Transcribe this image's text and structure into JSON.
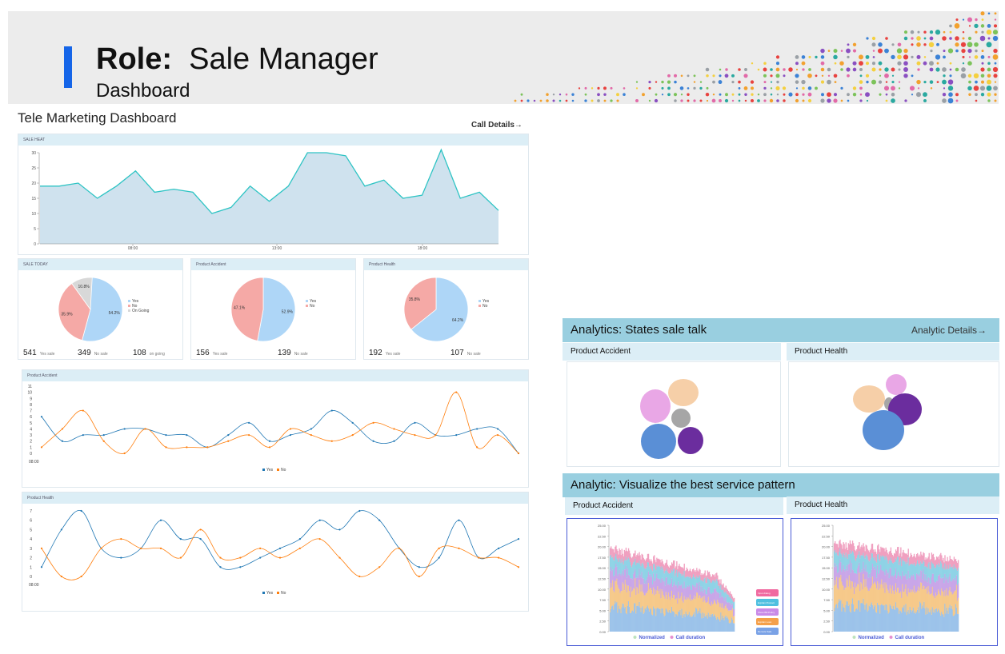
{
  "header": {
    "role_label": "Role:",
    "role_value": "Sale Manager",
    "subtitle": "Dashboard"
  },
  "tele": {
    "title": "Tele Marketing Dashboard",
    "call_details": "Call Details→",
    "sale_heat": {
      "label": "SALE HEAT",
      "yticks": [
        "30",
        "25",
        "20",
        "15",
        "10",
        "5",
        "0"
      ],
      "xticks": [
        "08:00",
        "13:00",
        "18:00"
      ],
      "values": [
        19,
        19,
        20,
        15,
        19,
        24,
        17,
        18,
        17,
        10,
        12,
        19,
        14,
        19,
        30,
        30,
        29,
        19,
        21,
        15,
        16,
        31,
        15,
        17,
        11
      ],
      "colors": {
        "line": "#2ec4c4",
        "fill": "#cfe2ee"
      }
    },
    "sale_today": {
      "label": "SALE TODAY",
      "pct": [
        "54.2%",
        "35.9%",
        "10.8%"
      ],
      "legend": [
        "Yes",
        "No",
        "On Going"
      ],
      "stats": [
        {
          "n": "541",
          "t": "Yes sale"
        },
        {
          "n": "349",
          "t": "No sale"
        },
        {
          "n": "108",
          "t": "on going"
        }
      ]
    },
    "pie_accident": {
      "label": "Product Accident",
      "pct": [
        "52.9%",
        "47.1%"
      ],
      "legend": [
        "Yes",
        "No"
      ],
      "stats": [
        {
          "n": "156",
          "t": "Yes sale"
        },
        {
          "n": "139",
          "t": "No sale"
        }
      ]
    },
    "pie_health": {
      "label": "Product Health",
      "pct": [
        "64.2%",
        "35.8%"
      ],
      "legend": [
        "Yes",
        "No"
      ],
      "stats": [
        {
          "n": "192",
          "t": "Yes sale"
        },
        {
          "n": "107",
          "t": "No sale"
        }
      ]
    },
    "line_accident": {
      "label": "Product Accident",
      "yticks": [
        "11",
        "10",
        "9",
        "8",
        "7",
        "6",
        "5",
        "4",
        "3",
        "2",
        "1",
        "0"
      ],
      "xlabel": "08:00",
      "yes": [
        6,
        2,
        3,
        3,
        4,
        4,
        3,
        3,
        1,
        3,
        5,
        2,
        3,
        4,
        7,
        5,
        2,
        2,
        5,
        3,
        3,
        4,
        4,
        0
      ],
      "no": [
        1,
        4,
        7,
        2,
        0,
        4,
        1,
        1,
        1,
        2,
        3,
        1,
        4,
        3,
        2,
        3,
        5,
        4,
        3,
        3,
        10,
        1,
        3,
        0
      ],
      "legend": [
        "Yes",
        "No"
      ]
    },
    "line_health": {
      "label": "Product Health",
      "yticks": [
        "7",
        "6",
        "5",
        "4",
        "3",
        "2",
        "1",
        "0"
      ],
      "xlabel": "08:00",
      "yes": [
        1,
        5,
        7,
        3,
        2,
        3,
        6,
        4,
        4,
        1,
        1,
        2,
        3,
        4,
        6,
        5,
        7,
        6,
        3,
        1,
        2,
        6,
        2,
        3,
        4
      ],
      "no": [
        3,
        0,
        0,
        3,
        4,
        3,
        3,
        2,
        5,
        2,
        2,
        3,
        2,
        3,
        4,
        2,
        0,
        1,
        3,
        0,
        3,
        3,
        2,
        2,
        1
      ],
      "legend": [
        "Yes",
        "No"
      ]
    },
    "colors": {
      "yes": "#aed6f7",
      "no": "#f5a9a6",
      "going": "#d8d8d8",
      "series_yes": "#1f77b4",
      "series_no": "#ff7f0e"
    }
  },
  "analytics": {
    "title": "Analytics: States sale talk",
    "details": "Analytic Details→",
    "panels": [
      "Product Accident",
      "Product Health"
    ],
    "pattern_title": "Analytic: Visualize the best service pattern",
    "pattern_panels": [
      "Product Accident",
      "Product Health"
    ],
    "pattern_yticks": [
      "25.00",
      "22.50",
      "20.00",
      "17.50",
      "15.00",
      "12.50",
      "10.00",
      "7.50",
      "5.00",
      "2.50",
      "0.00"
    ],
    "pattern_legend": [
      "Normalized",
      "Call duration"
    ],
    "pattern_keys": [
      "Input dialog",
      "Explain Product",
      "Show Bill Policy",
      "Explain Loan",
      "Remote Sale"
    ],
    "bubble_colors": [
      "#e9a7e6",
      "#f6cfa8",
      "#a6a6a6",
      "#5a8fd6",
      "#6b2d9e"
    ]
  }
}
